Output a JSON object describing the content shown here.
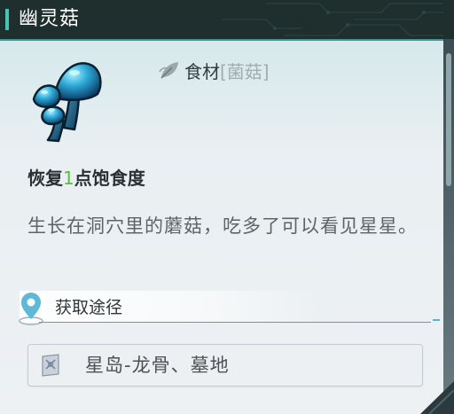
{
  "header": {
    "title": "幽灵菇",
    "accent_color": "#45c6b2",
    "bg_color": "#1f2f2e"
  },
  "item": {
    "icon": "blue-mushroom-icon"
  },
  "category": {
    "icon": "leaf-icon",
    "main": "食材",
    "sub": "[菌菇]"
  },
  "effect": {
    "prefix": "恢复",
    "value": "1",
    "suffix": "点饱食度",
    "value_color": "#54c23a"
  },
  "description": "生长在洞穴里的蘑菇，吃多了可以看见星星。",
  "obtain": {
    "icon": "location-pin-icon",
    "label": "获取途径"
  },
  "source": {
    "icon": "map-fragment-icon",
    "text": "星岛-龙骨、墓地"
  }
}
